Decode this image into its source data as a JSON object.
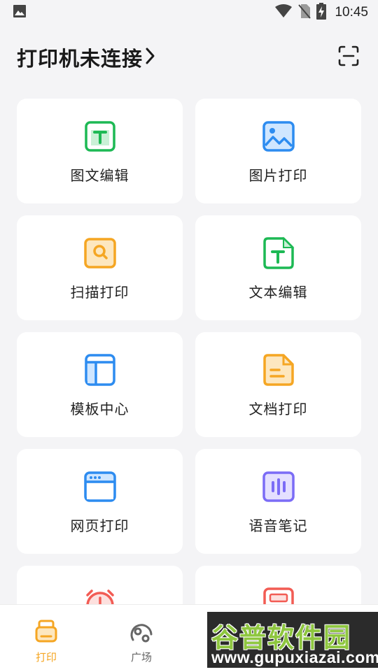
{
  "status_bar": {
    "time": "10:45",
    "icons": [
      "image-icon",
      "wifi-icon",
      "no-sim-icon",
      "battery-charging-icon"
    ]
  },
  "header": {
    "printer_status": "打印机未连接",
    "chevron": "›",
    "scan_icon": "scan-icon"
  },
  "features": [
    {
      "label": "图文编辑",
      "icon": "text-image-edit-icon",
      "color": "#1db954"
    },
    {
      "label": "图片打印",
      "icon": "picture-print-icon",
      "color": "#2d8cf0"
    },
    {
      "label": "扫描打印",
      "icon": "scan-print-icon",
      "color": "#f5a623"
    },
    {
      "label": "文本编辑",
      "icon": "text-edit-icon",
      "color": "#1db954"
    },
    {
      "label": "模板中心",
      "icon": "template-center-icon",
      "color": "#2d8cf0"
    },
    {
      "label": "文档打印",
      "icon": "document-print-icon",
      "color": "#f5a623"
    },
    {
      "label": "网页打印",
      "icon": "web-print-icon",
      "color": "#2d8cf0"
    },
    {
      "label": "语音笔记",
      "icon": "voice-note-icon",
      "color": "#7b6cf6"
    },
    {
      "label": "",
      "icon": "timer-icon",
      "color": "#f25c54"
    },
    {
      "label": "",
      "icon": "note-icon",
      "color": "#f25c54"
    }
  ],
  "bottom_nav": {
    "items": [
      {
        "label": "打印",
        "icon": "print-nav-icon",
        "active": true
      },
      {
        "label": "广场",
        "icon": "square-nav-icon",
        "active": false
      }
    ],
    "active_color": "#f5a623"
  },
  "watermark": {
    "title": "谷普软件园",
    "url": "www.gupuxiazai.com"
  }
}
